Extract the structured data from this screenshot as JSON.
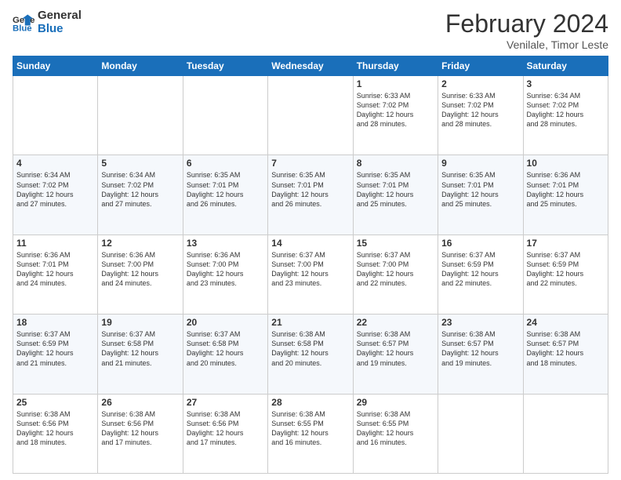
{
  "header": {
    "logo_general": "General",
    "logo_blue": "Blue",
    "month_title": "February 2024",
    "location": "Venilale, Timor Leste"
  },
  "days_of_week": [
    "Sunday",
    "Monday",
    "Tuesday",
    "Wednesday",
    "Thursday",
    "Friday",
    "Saturday"
  ],
  "weeks": [
    [
      {
        "day": "",
        "info": ""
      },
      {
        "day": "",
        "info": ""
      },
      {
        "day": "",
        "info": ""
      },
      {
        "day": "",
        "info": ""
      },
      {
        "day": "1",
        "info": "Sunrise: 6:33 AM\nSunset: 7:02 PM\nDaylight: 12 hours\nand 28 minutes."
      },
      {
        "day": "2",
        "info": "Sunrise: 6:33 AM\nSunset: 7:02 PM\nDaylight: 12 hours\nand 28 minutes."
      },
      {
        "day": "3",
        "info": "Sunrise: 6:34 AM\nSunset: 7:02 PM\nDaylight: 12 hours\nand 28 minutes."
      }
    ],
    [
      {
        "day": "4",
        "info": "Sunrise: 6:34 AM\nSunset: 7:02 PM\nDaylight: 12 hours\nand 27 minutes."
      },
      {
        "day": "5",
        "info": "Sunrise: 6:34 AM\nSunset: 7:02 PM\nDaylight: 12 hours\nand 27 minutes."
      },
      {
        "day": "6",
        "info": "Sunrise: 6:35 AM\nSunset: 7:01 PM\nDaylight: 12 hours\nand 26 minutes."
      },
      {
        "day": "7",
        "info": "Sunrise: 6:35 AM\nSunset: 7:01 PM\nDaylight: 12 hours\nand 26 minutes."
      },
      {
        "day": "8",
        "info": "Sunrise: 6:35 AM\nSunset: 7:01 PM\nDaylight: 12 hours\nand 25 minutes."
      },
      {
        "day": "9",
        "info": "Sunrise: 6:35 AM\nSunset: 7:01 PM\nDaylight: 12 hours\nand 25 minutes."
      },
      {
        "day": "10",
        "info": "Sunrise: 6:36 AM\nSunset: 7:01 PM\nDaylight: 12 hours\nand 25 minutes."
      }
    ],
    [
      {
        "day": "11",
        "info": "Sunrise: 6:36 AM\nSunset: 7:01 PM\nDaylight: 12 hours\nand 24 minutes."
      },
      {
        "day": "12",
        "info": "Sunrise: 6:36 AM\nSunset: 7:00 PM\nDaylight: 12 hours\nand 24 minutes."
      },
      {
        "day": "13",
        "info": "Sunrise: 6:36 AM\nSunset: 7:00 PM\nDaylight: 12 hours\nand 23 minutes."
      },
      {
        "day": "14",
        "info": "Sunrise: 6:37 AM\nSunset: 7:00 PM\nDaylight: 12 hours\nand 23 minutes."
      },
      {
        "day": "15",
        "info": "Sunrise: 6:37 AM\nSunset: 7:00 PM\nDaylight: 12 hours\nand 22 minutes."
      },
      {
        "day": "16",
        "info": "Sunrise: 6:37 AM\nSunset: 6:59 PM\nDaylight: 12 hours\nand 22 minutes."
      },
      {
        "day": "17",
        "info": "Sunrise: 6:37 AM\nSunset: 6:59 PM\nDaylight: 12 hours\nand 22 minutes."
      }
    ],
    [
      {
        "day": "18",
        "info": "Sunrise: 6:37 AM\nSunset: 6:59 PM\nDaylight: 12 hours\nand 21 minutes."
      },
      {
        "day": "19",
        "info": "Sunrise: 6:37 AM\nSunset: 6:58 PM\nDaylight: 12 hours\nand 21 minutes."
      },
      {
        "day": "20",
        "info": "Sunrise: 6:37 AM\nSunset: 6:58 PM\nDaylight: 12 hours\nand 20 minutes."
      },
      {
        "day": "21",
        "info": "Sunrise: 6:38 AM\nSunset: 6:58 PM\nDaylight: 12 hours\nand 20 minutes."
      },
      {
        "day": "22",
        "info": "Sunrise: 6:38 AM\nSunset: 6:57 PM\nDaylight: 12 hours\nand 19 minutes."
      },
      {
        "day": "23",
        "info": "Sunrise: 6:38 AM\nSunset: 6:57 PM\nDaylight: 12 hours\nand 19 minutes."
      },
      {
        "day": "24",
        "info": "Sunrise: 6:38 AM\nSunset: 6:57 PM\nDaylight: 12 hours\nand 18 minutes."
      }
    ],
    [
      {
        "day": "25",
        "info": "Sunrise: 6:38 AM\nSunset: 6:56 PM\nDaylight: 12 hours\nand 18 minutes."
      },
      {
        "day": "26",
        "info": "Sunrise: 6:38 AM\nSunset: 6:56 PM\nDaylight: 12 hours\nand 17 minutes."
      },
      {
        "day": "27",
        "info": "Sunrise: 6:38 AM\nSunset: 6:56 PM\nDaylight: 12 hours\nand 17 minutes."
      },
      {
        "day": "28",
        "info": "Sunrise: 6:38 AM\nSunset: 6:55 PM\nDaylight: 12 hours\nand 16 minutes."
      },
      {
        "day": "29",
        "info": "Sunrise: 6:38 AM\nSunset: 6:55 PM\nDaylight: 12 hours\nand 16 minutes."
      },
      {
        "day": "",
        "info": ""
      },
      {
        "day": "",
        "info": ""
      }
    ]
  ]
}
